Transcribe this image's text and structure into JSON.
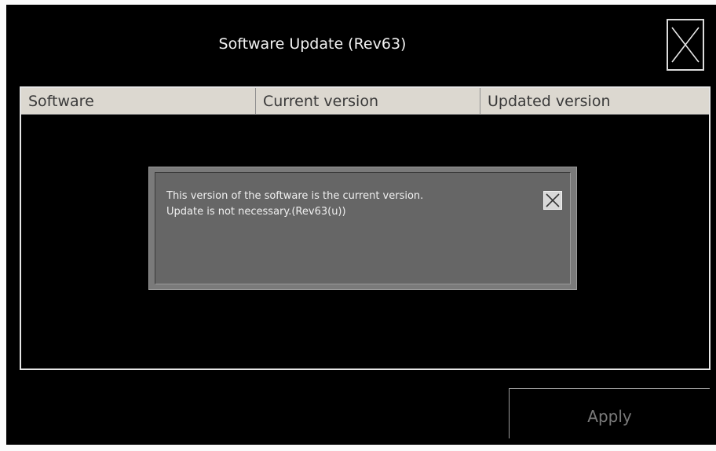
{
  "header": {
    "title": "Software Update (Rev63)",
    "close_icon": "close-icon"
  },
  "table": {
    "columns": [
      "Software",
      "Current version",
      "Updated version"
    ],
    "rows": []
  },
  "dialog": {
    "message_line1": "This version of the software is the current version.",
    "message_line2": "Update is not necessary.(Rev63(u))",
    "close_icon": "close-icon"
  },
  "footer": {
    "apply_label": "Apply",
    "apply_enabled": false
  },
  "colors": {
    "background": "#000000",
    "table_header": "#dcd8d0",
    "dialog": "#666666",
    "apply_disabled_text": "#7a7a7a"
  }
}
